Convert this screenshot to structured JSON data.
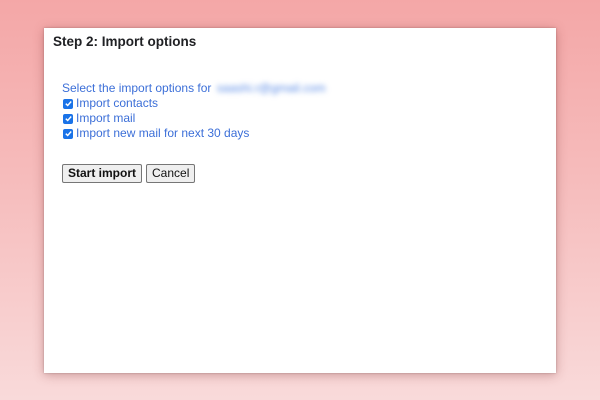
{
  "dialog": {
    "title": "Step 2: Import options",
    "prompt": "Select the import options for",
    "email": "saashi.r@gmail.com",
    "options": [
      {
        "label": "Import contacts",
        "checked": true
      },
      {
        "label": "Import mail",
        "checked": true
      },
      {
        "label": "Import new mail for next 30 days",
        "checked": true
      }
    ],
    "buttons": {
      "start_label": "Start import",
      "cancel_label": "Cancel"
    }
  },
  "colors": {
    "accent": "#1a73e8",
    "link_text": "#3c6fd8",
    "background_top": "#f4a7a7",
    "background_bottom": "#f9dada"
  },
  "icons": {
    "checkbox": "checkmark-icon"
  }
}
